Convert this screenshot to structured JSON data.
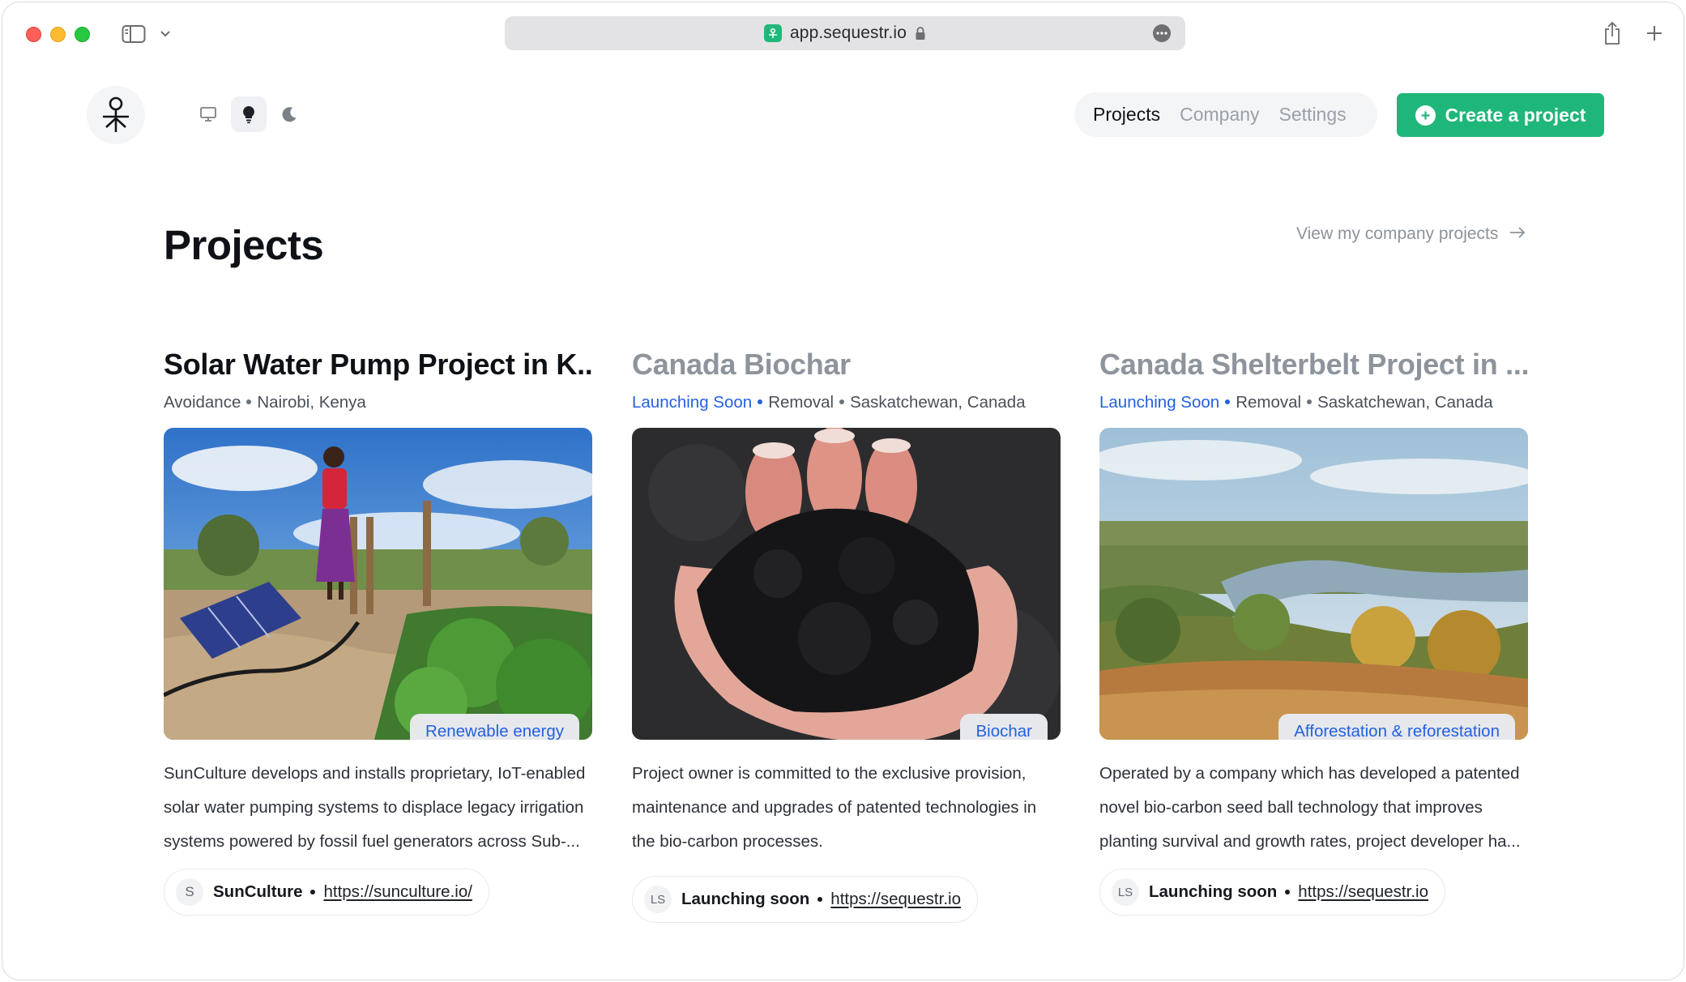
{
  "browser": {
    "url": "app.sequestr.io"
  },
  "header": {
    "nav": [
      {
        "label": "Projects",
        "active": true
      },
      {
        "label": "Company",
        "active": false
      },
      {
        "label": "Settings",
        "active": false
      }
    ],
    "create_label": "Create a project",
    "theme_options": [
      "desktop-icon",
      "lightbulb-icon",
      "moon-icon"
    ],
    "theme_selected": "lightbulb-icon"
  },
  "page": {
    "title": "Projects",
    "company_link": "View my company projects"
  },
  "cards": [
    {
      "title": "Solar Water Pump Project in K...",
      "status": "",
      "category": "Avoidance",
      "location": "Nairobi, Kenya",
      "tag": "Renewable energy",
      "description": "SunCulture develops and installs proprietary, IoT-enabled solar water pumping systems to displace legacy irrigation systems powered by fossil fuel generators across Sub-...",
      "avatar": "S",
      "owner": "SunCulture",
      "link": "https://sunculture.io/"
    },
    {
      "title": "Canada Biochar",
      "status": "Launching Soon",
      "category": "Removal",
      "location": "Saskatchewan, Canada",
      "tag": "Biochar",
      "description": "Project owner is committed to the exclusive provision, maintenance and upgrades of patented technologies in the bio-carbon processes.",
      "avatar": "LS",
      "owner": "Launching soon",
      "link": "https://sequestr.io"
    },
    {
      "title": "Canada Shelterbelt Project in ...",
      "status": "Launching Soon",
      "category": "Removal",
      "location": "Saskatchewan, Canada",
      "tag": "Afforestation & reforestation",
      "description": "Operated by a company which has developed a patented novel bio-carbon seed ball technology that improves planting survival and growth rates, project developer ha...",
      "avatar": "LS",
      "owner": "Launching soon",
      "link": "https://sequestr.io"
    }
  ],
  "colors": {
    "accent_green": "#1fb67a",
    "link_blue": "#2461e0",
    "muted_text": "#8e949c"
  }
}
